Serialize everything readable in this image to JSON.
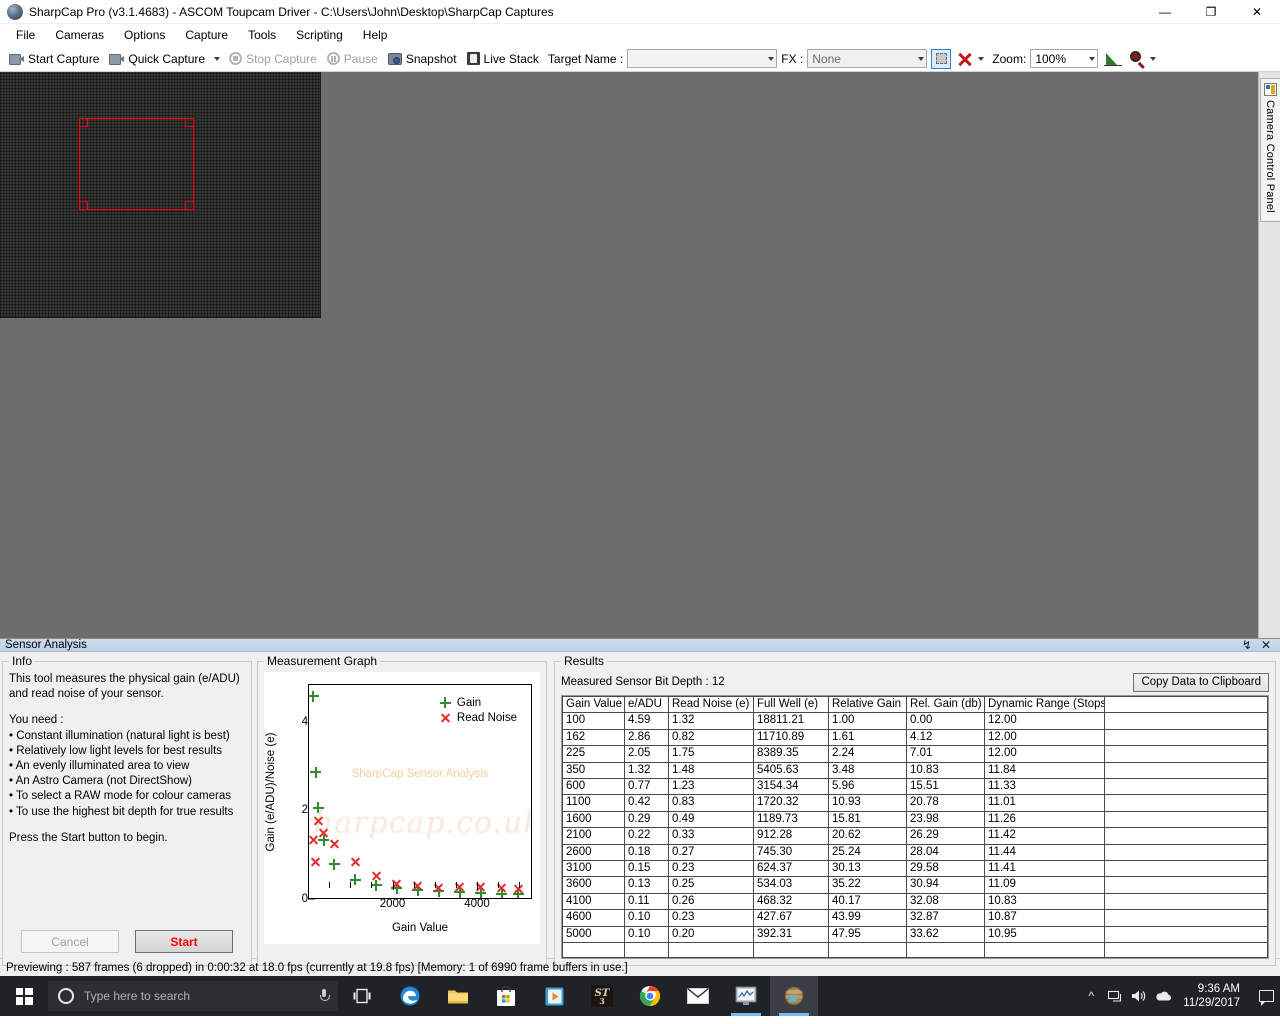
{
  "window": {
    "title": "SharpCap Pro (v3.1.4683) - ASCOM Toupcam Driver - C:\\Users\\John\\Desktop\\SharpCap Captures",
    "minimize": "—",
    "maximize": "❐",
    "close": "✕"
  },
  "menu": [
    "File",
    "Cameras",
    "Options",
    "Capture",
    "Tools",
    "Scripting",
    "Help"
  ],
  "toolbar": {
    "start_capture": "Start Capture",
    "quick_capture": "Quick Capture",
    "stop_capture": "Stop Capture",
    "pause": "Pause",
    "snapshot": "Snapshot",
    "live_stack": "Live Stack",
    "target_name_label": "Target Name :",
    "target_name_value": "",
    "fx_label": "FX :",
    "fx_value": "None",
    "zoom_label": "Zoom:",
    "zoom_value": "100%"
  },
  "right_dock": {
    "camera_control_panel": "Camera Control Panel"
  },
  "sensor_analysis": {
    "panel_title": "Sensor Analysis",
    "pin": "↯",
    "close": "✕",
    "info": {
      "legend": "Info",
      "line1": "This tool measures the physical gain (e/ADU)",
      "line2": "and read noise of your sensor.",
      "needs_title": "You need :",
      "bullets": [
        "• Constant illumination (natural light is best)",
        "• Relatively low light levels for best results",
        "• An evenly illuminated area to view",
        "• An Astro Camera (not DirectShow)",
        "• To select a RAW mode for colour cameras",
        "• To use the highest bit depth for true results"
      ],
      "footer": "Press the Start button to begin.",
      "cancel_label": "Cancel",
      "start_label": "Start"
    },
    "graph": {
      "legend": "Measurement Graph"
    },
    "results": {
      "legend": "Results",
      "bit_depth_label": "Measured Sensor Bit Depth :",
      "bit_depth_value": "12",
      "copy_label": "Copy Data to Clipboard"
    }
  },
  "chart_data": {
    "type": "scatter",
    "title": "Measurement Graph",
    "watermark_title": "SharpCap Sensor Analysis",
    "watermark_url": "sharpcap.co.uk",
    "xlabel": "Gain Value",
    "ylabel": "Gain (e/ADU)/Noise (e)",
    "xlim": [
      0,
      5300
    ],
    "ylim": [
      0,
      4.85
    ],
    "xticks": [
      2000,
      4000
    ],
    "xtick_labels": [
      "2000",
      "4000"
    ],
    "yticks": [
      0,
      2,
      4
    ],
    "ytick_labels": [
      "0",
      "2",
      "4"
    ],
    "y_minor_ticks": [
      0.5,
      1,
      1.5,
      2.5,
      3,
      3.5,
      4.5
    ],
    "x_minor_ticks": [
      500,
      1000,
      1500,
      2500,
      3000,
      3500,
      4500,
      5000
    ],
    "grid": false,
    "legend_position": "top-right",
    "series": [
      {
        "name": "Gain",
        "marker": "plus",
        "color": "#2e8b2e",
        "x": [
          100,
          162,
          225,
          350,
          600,
          1100,
          1600,
          2100,
          2600,
          3100,
          3600,
          4100,
          4600,
          5000
        ],
        "y": [
          4.59,
          2.86,
          2.05,
          1.32,
          0.77,
          0.42,
          0.29,
          0.22,
          0.18,
          0.15,
          0.13,
          0.11,
          0.1,
          0.1
        ]
      },
      {
        "name": "Read Noise",
        "marker": "cross",
        "color": "#e03030",
        "x": [
          100,
          162,
          225,
          350,
          600,
          1100,
          1600,
          2100,
          2600,
          3100,
          3600,
          4100,
          4600,
          5000
        ],
        "y": [
          1.32,
          0.82,
          1.75,
          1.48,
          1.23,
          0.83,
          0.49,
          0.33,
          0.27,
          0.23,
          0.25,
          0.26,
          0.23,
          0.2
        ]
      }
    ]
  },
  "results_table": {
    "headers": [
      "Gain Value",
      "e/ADU",
      "Read Noise (e)",
      "Full Well (e)",
      "Relative Gain",
      "Rel. Gain (db)",
      "Dynamic Range (Stops)",
      ""
    ],
    "rows": [
      [
        "100",
        "4.59",
        "1.32",
        "18811.21",
        "1.00",
        "0.00",
        "12.00",
        ""
      ],
      [
        "162",
        "2.86",
        "0.82",
        "11710.89",
        "1.61",
        "4.12",
        "12.00",
        ""
      ],
      [
        "225",
        "2.05",
        "1.75",
        "8389.35",
        "2.24",
        "7.01",
        "12.00",
        ""
      ],
      [
        "350",
        "1.32",
        "1.48",
        "5405.63",
        "3.48",
        "10.83",
        "11.84",
        ""
      ],
      [
        "600",
        "0.77",
        "1.23",
        "3154.34",
        "5.96",
        "15.51",
        "11.33",
        ""
      ],
      [
        "1100",
        "0.42",
        "0.83",
        "1720.32",
        "10.93",
        "20.78",
        "11.01",
        ""
      ],
      [
        "1600",
        "0.29",
        "0.49",
        "1189.73",
        "15.81",
        "23.98",
        "11.26",
        ""
      ],
      [
        "2100",
        "0.22",
        "0.33",
        "912.28",
        "20.62",
        "26.29",
        "11.42",
        ""
      ],
      [
        "2600",
        "0.18",
        "0.27",
        "745.30",
        "25.24",
        "28.04",
        "11.44",
        ""
      ],
      [
        "3100",
        "0.15",
        "0.23",
        "624.37",
        "30.13",
        "29.58",
        "11.41",
        ""
      ],
      [
        "3600",
        "0.13",
        "0.25",
        "534.03",
        "35.22",
        "30.94",
        "11.09",
        ""
      ],
      [
        "4100",
        "0.11",
        "0.26",
        "468.32",
        "40.17",
        "32.08",
        "10.83",
        ""
      ],
      [
        "4600",
        "0.10",
        "0.23",
        "427.67",
        "43.99",
        "32.87",
        "10.87",
        ""
      ],
      [
        "5000",
        "0.10",
        "0.20",
        "392.31",
        "47.95",
        "33.62",
        "10.95",
        ""
      ],
      [
        "",
        "",
        "",
        "",
        "",
        "",
        "",
        ""
      ]
    ]
  },
  "statusbar": {
    "text": "Previewing : 587 frames (6 dropped) in 0:00:32 at 18.0 fps  (currently at 19.8 fps) [Memory: 1 of 6990 frame buffers in use.]"
  },
  "taskbar": {
    "search_placeholder": "Type here to search",
    "clock_time": "9:36 AM",
    "clock_date": "11/29/2017"
  }
}
